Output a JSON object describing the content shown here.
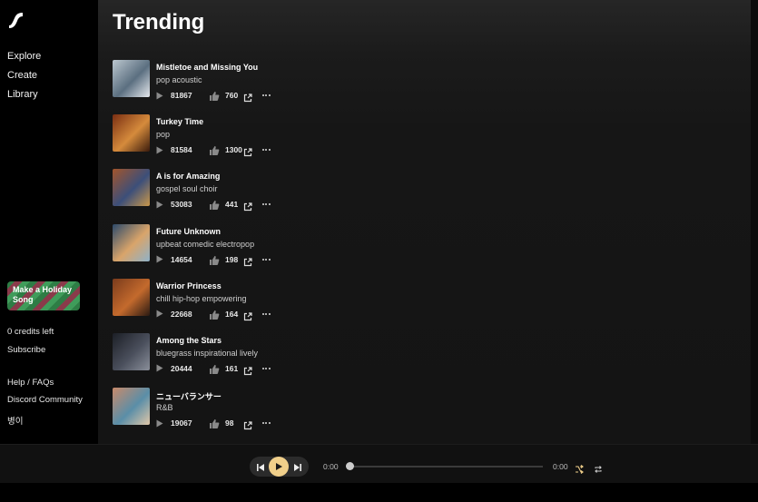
{
  "sidebar": {
    "logo_icon": "suno-wave-logo-icon",
    "nav": [
      {
        "label": "Explore"
      },
      {
        "label": "Create"
      },
      {
        "label": "Library"
      }
    ],
    "promo_label": "Make a Holiday Song",
    "credits_label": "0 credits left",
    "subscribe_label": "Subscribe",
    "help_label": "Help / FAQs",
    "discord_label": "Discord Community",
    "user_label": "병이"
  },
  "main": {
    "title": "Trending",
    "songs": [
      {
        "title": "Mistletoe and Missing You",
        "tags": "pop acoustic",
        "plays": "81867",
        "likes": "760",
        "cover_colors": [
          "#bcc7cf",
          "#5b6f80",
          "#e6e9ee"
        ]
      },
      {
        "title": "Turkey Time",
        "tags": "pop",
        "plays": "81584",
        "likes": "1300",
        "cover_colors": [
          "#7a2e12",
          "#d58b3c",
          "#3a1a0c"
        ]
      },
      {
        "title": "A is for Amazing",
        "tags": "gospel soul choir",
        "plays": "53083",
        "likes": "441",
        "cover_colors": [
          "#a3552b",
          "#3c4f7a",
          "#c9974a"
        ]
      },
      {
        "title": "Future Unknown",
        "tags": "upbeat comedic electropop",
        "plays": "14654",
        "likes": "198",
        "cover_colors": [
          "#2c4a6b",
          "#d9a46a",
          "#8fb2c9"
        ]
      },
      {
        "title": "Warrior Princess",
        "tags": "chill hip-hop empowering",
        "plays": "22668",
        "likes": "164",
        "cover_colors": [
          "#7a3b1c",
          "#c46a2d",
          "#2a1a12"
        ]
      },
      {
        "title": "Among the Stars",
        "tags": "bluegrass inspirational lively",
        "plays": "20444",
        "likes": "161",
        "cover_colors": [
          "#1c1f26",
          "#4a4f5c",
          "#8a8f9a"
        ]
      },
      {
        "title": "ニューバランサー",
        "tags": "R&B",
        "plays": "19067",
        "likes": "98",
        "cover_colors": [
          "#c98a6a",
          "#5a8ea8",
          "#e0c7a8"
        ]
      }
    ]
  },
  "player": {
    "time_current": "0:00",
    "time_total": "0:00",
    "progress": 0,
    "accent_color": "#f0cf8a"
  }
}
